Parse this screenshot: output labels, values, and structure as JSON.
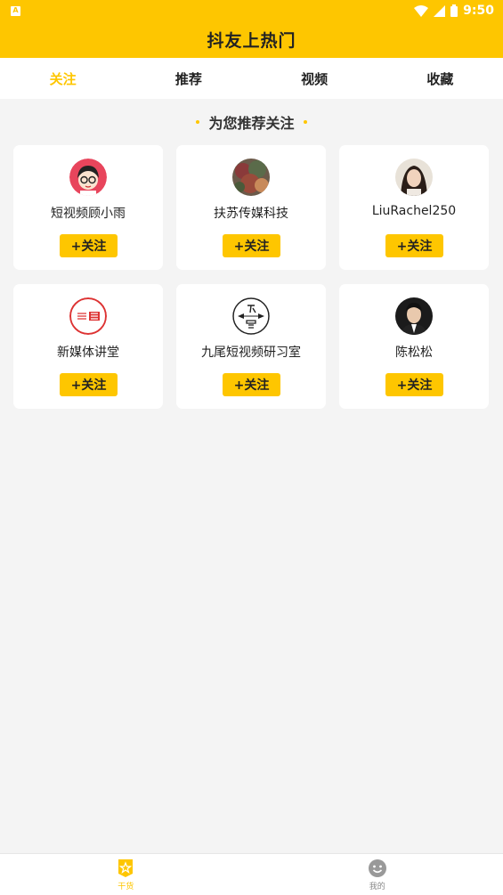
{
  "status_bar": {
    "time": "9:50",
    "notif_icon": "app-notification-icon"
  },
  "app_title": "抖友上热门",
  "tabs": [
    {
      "label": "关注",
      "active": true
    },
    {
      "label": "推荐",
      "active": false
    },
    {
      "label": "视频",
      "active": false
    },
    {
      "label": "收藏",
      "active": false
    }
  ],
  "section_title": "为您推荐关注",
  "recommendations": [
    {
      "name": "短视频顾小雨",
      "button": "+关注",
      "avatar": "cartoon-girl-avatar"
    },
    {
      "name": "扶苏传媒科技",
      "button": "+关注",
      "avatar": "painting-avatar"
    },
    {
      "name": "LiuRachel250",
      "button": "+关注",
      "avatar": "woman-photo-avatar"
    },
    {
      "name": "新媒体讲堂",
      "button": "+关注",
      "avatar": "toutiao-logo-avatar"
    },
    {
      "name": "九尾短视频研习室",
      "button": "+关注",
      "avatar": "jiuwei-logo-avatar"
    },
    {
      "name": "陈松松",
      "button": "+关注",
      "avatar": "man-photo-avatar"
    }
  ],
  "bottom_nav": [
    {
      "label": "干货",
      "icon": "star-badge-icon",
      "active": true
    },
    {
      "label": "我的",
      "icon": "smiley-icon",
      "active": false
    }
  ],
  "colors": {
    "accent": "#fec600",
    "background": "#f4f4f4"
  }
}
